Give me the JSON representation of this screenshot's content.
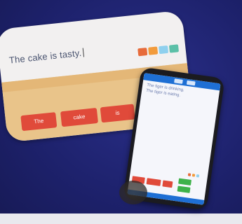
{
  "tablet1": {
    "sentence": "The cake is tasty.",
    "tool_colors": [
      "#e76b3a",
      "#f29b3c",
      "#8fd0ee",
      "#5cc0a8"
    ],
    "word_tiles": [
      {
        "label": "The",
        "color": "#e04a3a"
      },
      {
        "label": "cake",
        "color": "#e04a3a"
      },
      {
        "label": "is",
        "color": "#e04a3a"
      },
      {
        "label": "",
        "color": "#c968b8"
      }
    ]
  },
  "tablet2": {
    "lines": [
      "The tiger is drinking.",
      "The tiger is eating."
    ],
    "accent": "#1e6fd4"
  }
}
